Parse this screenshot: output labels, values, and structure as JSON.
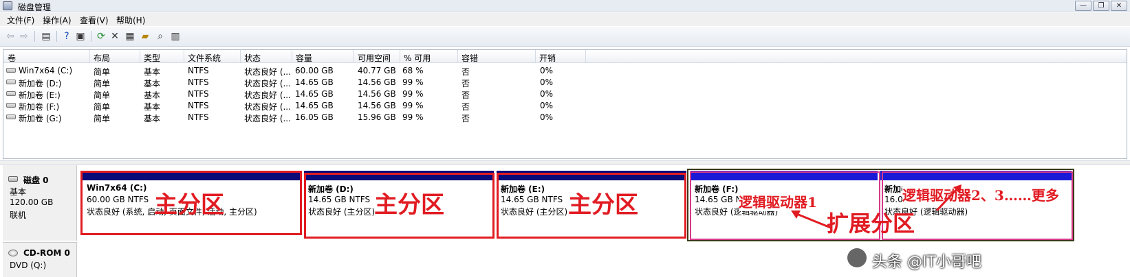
{
  "window": {
    "title": "磁盘管理",
    "controls": {
      "minimize": "—",
      "restore": "❐",
      "close": "✕"
    }
  },
  "menu": [
    "文件(F)",
    "操作(A)",
    "查看(V)",
    "帮助(H)"
  ],
  "toolbar_icons": [
    "back-icon",
    "forward-icon",
    "view-icon",
    "help-icon",
    "console-icon",
    "refresh-icon",
    "delete-icon",
    "properties-icon",
    "open-icon",
    "search-icon",
    "export-icon"
  ],
  "volume_table": {
    "columns": [
      "卷",
      "布局",
      "类型",
      "文件系统",
      "状态",
      "容量",
      "可用空间",
      "% 可用",
      "容错",
      "开销"
    ],
    "rows": [
      [
        "Win7x64 (C:)",
        "简单",
        "基本",
        "NTFS",
        "状态良好 (...",
        "60.00 GB",
        "40.77 GB",
        "68 %",
        "否",
        "0%"
      ],
      [
        "新加卷 (D:)",
        "简单",
        "基本",
        "NTFS",
        "状态良好 (...",
        "14.65 GB",
        "14.56 GB",
        "99 %",
        "否",
        "0%"
      ],
      [
        "新加卷 (E:)",
        "简单",
        "基本",
        "NTFS",
        "状态良好 (...",
        "14.65 GB",
        "14.56 GB",
        "99 %",
        "否",
        "0%"
      ],
      [
        "新加卷 (F:)",
        "简单",
        "基本",
        "NTFS",
        "状态良好 (...",
        "14.65 GB",
        "14.56 GB",
        "99 %",
        "否",
        "0%"
      ],
      [
        "新加卷 (G:)",
        "简单",
        "基本",
        "NTFS",
        "状态良好 (...",
        "16.05 GB",
        "15.96 GB",
        "99 %",
        "否",
        "0%"
      ]
    ]
  },
  "disk0": {
    "name": "磁盘 0",
    "type": "基本",
    "size": "120.00 GB",
    "status": "联机",
    "partitions": [
      {
        "name": "Win7x64  (C:)",
        "size": "60.00 GB NTFS",
        "status": "状态良好 (系统, 启动, 页面文件, 活动, 主分区)",
        "bar_color": "#0a0a78"
      },
      {
        "name": "新加卷  (D:)",
        "size": "14.65 GB NTFS",
        "status": "状态良好 (主分区)",
        "bar_color": "#0a0a78"
      },
      {
        "name": "新加卷  (E:)",
        "size": "14.65 GB NTFS",
        "status": "状态良好 (主分区)",
        "bar_color": "#0a0a78"
      },
      {
        "name": "新加卷  (F:)",
        "size": "14.65 GB NTFS",
        "status": "状态良好 (逻辑驱动器)",
        "bar_color": "#1a1ad6"
      },
      {
        "name": "新加卷  (G:)",
        "size": "16.05 GB NTFS",
        "status": "状态良好 (逻辑驱动器)",
        "bar_color": "#1a1ad6"
      }
    ]
  },
  "cdrom0": {
    "name": "CD-ROM 0",
    "line": "DVD (Q:)"
  },
  "annotations": {
    "primary": "主分区",
    "logical1": "逻辑驱动器1",
    "logical_more": "逻辑驱动器2、3……更多",
    "extended": "扩展分区"
  },
  "watermark": "头条 @IT小哥吧",
  "colors": {
    "annotation_red": "#e11b22",
    "primary_bar": "#0a0a78",
    "logical_bar": "#1a1ad6"
  }
}
